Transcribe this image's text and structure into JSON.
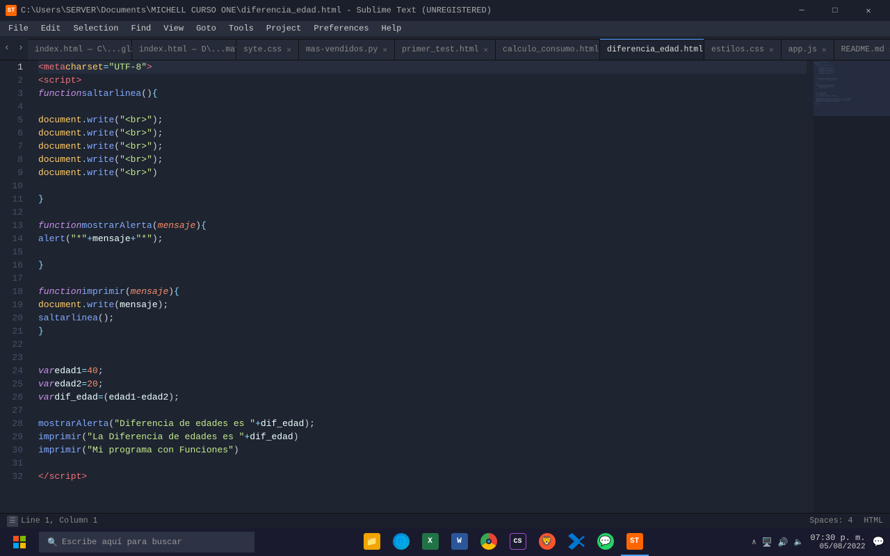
{
  "titlebar": {
    "title": "C:\\Users\\SERVER\\Documents\\MICHELL CURSO ONE\\diferencia_edad.html - Sublime Text (UNREGISTERED)",
    "app_icon": "ST",
    "min_label": "─",
    "max_label": "□",
    "close_label": "✕"
  },
  "menubar": {
    "items": [
      "File",
      "Edit",
      "Selection",
      "Find",
      "View",
      "Goto",
      "Tools",
      "Project",
      "Preferences",
      "Help"
    ]
  },
  "tabs": [
    {
      "label": "index.html — C:\\...\\glider",
      "active": false
    },
    {
      "label": "index.html — D:\\...\\matcha",
      "active": false
    },
    {
      "label": "syte.css",
      "active": false
    },
    {
      "label": "mas-vendidos.py",
      "active": false
    },
    {
      "label": "primer_test.html",
      "active": false
    },
    {
      "label": "calculo_consumo.html",
      "active": false
    },
    {
      "label": "diferencia_edad.html",
      "active": true
    },
    {
      "label": "estilos.css",
      "active": false
    },
    {
      "label": "app.js",
      "active": false
    },
    {
      "label": "README.md",
      "active": false
    }
  ],
  "statusbar": {
    "line_col": "Line 1, Column 1",
    "spaces": "Spaces: 4",
    "syntax": "HTML"
  },
  "taskbar": {
    "search_placeholder": "Escribe aquí para buscar",
    "time": "07:30 p. m.",
    "date": "05/08/2022"
  }
}
